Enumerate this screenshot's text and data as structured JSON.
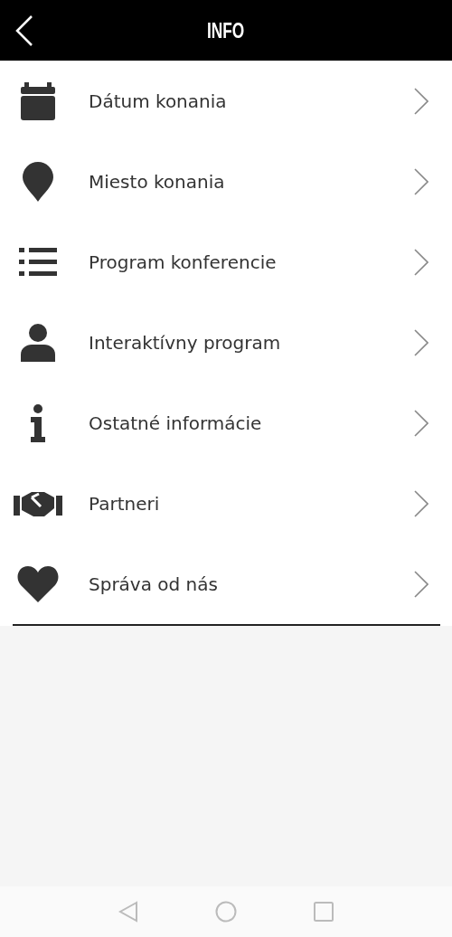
{
  "header": {
    "title": "INFO"
  },
  "items": [
    {
      "kind": "calendar",
      "label": "Dátum konania"
    },
    {
      "kind": "pin",
      "label": "Miesto konania"
    },
    {
      "kind": "list",
      "label": "Program konferencie"
    },
    {
      "kind": "person",
      "label": "Interaktívny program"
    },
    {
      "kind": "info",
      "label": "Ostatné informácie"
    },
    {
      "kind": "handshake",
      "label": "Partneri"
    },
    {
      "kind": "heart",
      "label": "Správa od nás"
    }
  ]
}
